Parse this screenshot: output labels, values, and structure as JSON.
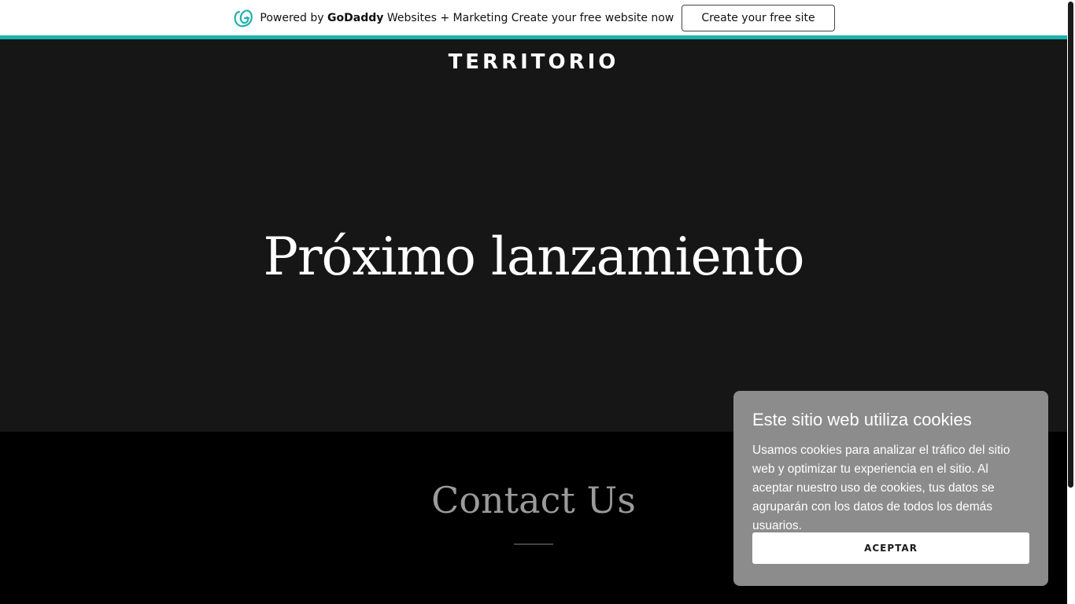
{
  "promo_bar": {
    "powered_by": "Powered by",
    "brand": "GoDaddy",
    "tagline": "Websites + Marketing Create your free website now",
    "button_label": "Create your free site",
    "logo_icon": "godaddy-logo-icon",
    "accent_color": "#1bb3ad"
  },
  "header": {
    "site_title": "TERRITORIO"
  },
  "hero": {
    "heading": "Próximo lanzamiento"
  },
  "contact": {
    "heading": "Contact Us"
  },
  "cookie_banner": {
    "title": "Este sitio web utiliza cookies",
    "body": "Usamos cookies para analizar el tráfico del sitio web y optimizar tu experiencia en el sitio. Al aceptar nuestro uso de cookies, tus datos se agruparán con los datos de todos los demás usuarios.",
    "accept_label": "ACEPTAR"
  }
}
